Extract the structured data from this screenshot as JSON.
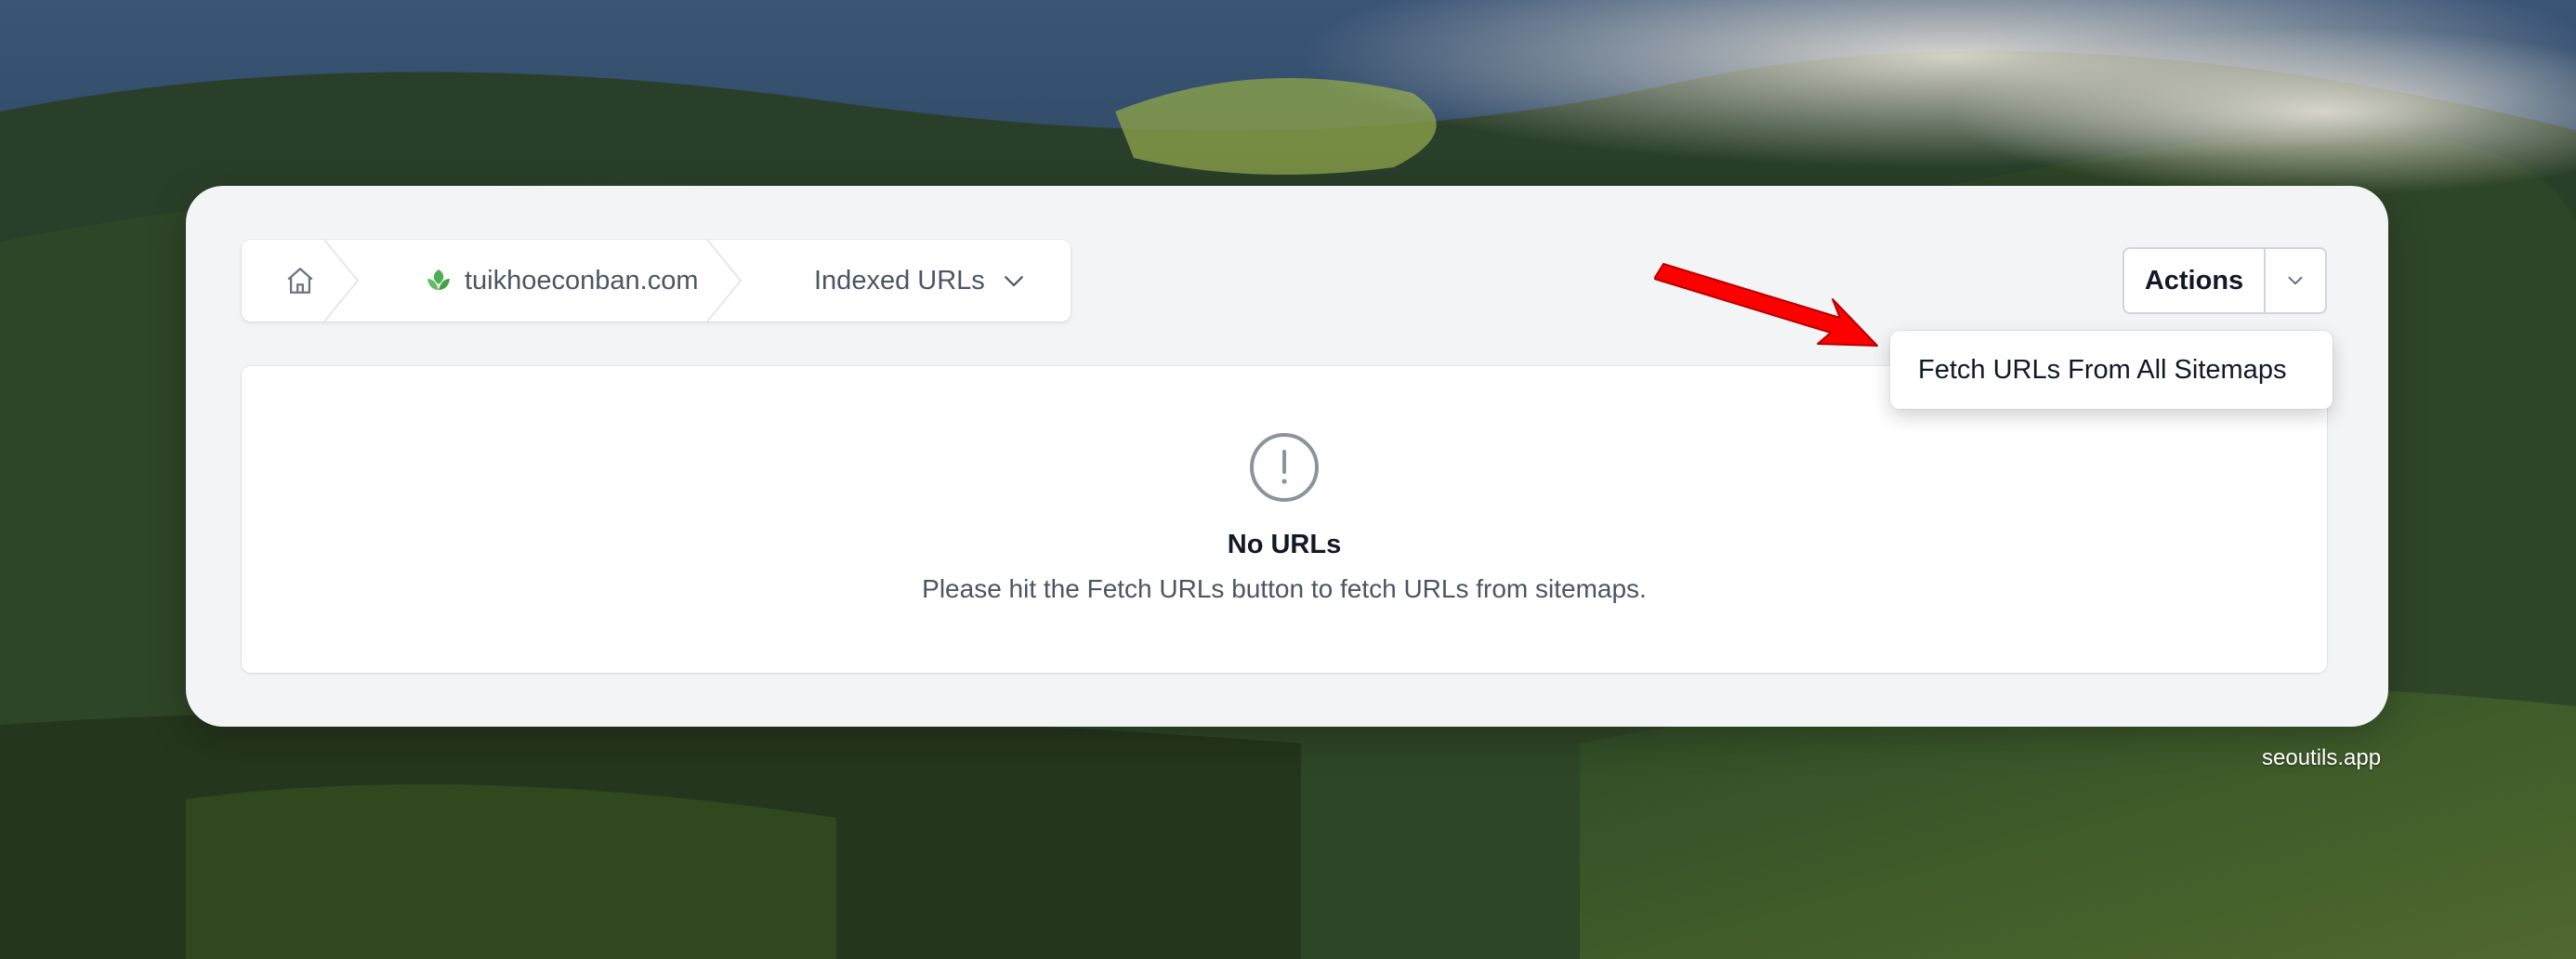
{
  "breadcrumb": {
    "home_icon": "home-icon",
    "site_label": "tuikhoeconban.com",
    "site_icon": "leaf-logo-icon",
    "page_label": "Indexed URLs",
    "page_icon": "chevron-down-icon"
  },
  "actions": {
    "label": "Actions",
    "toggle_icon": "chevron-down-icon"
  },
  "dropdown": {
    "items": [
      {
        "label": "Fetch URLs From All Sitemaps"
      }
    ]
  },
  "empty_state": {
    "icon": "exclamation-circle-icon",
    "title": "No URLs",
    "description": "Please hit the Fetch URLs button to fetch URLs from sitemaps."
  },
  "footer": {
    "text": "seoutils.app"
  },
  "colors": {
    "card_bg": "#f3f4f6",
    "arrow": "#ff0000",
    "accent_green": "#4caf50"
  }
}
